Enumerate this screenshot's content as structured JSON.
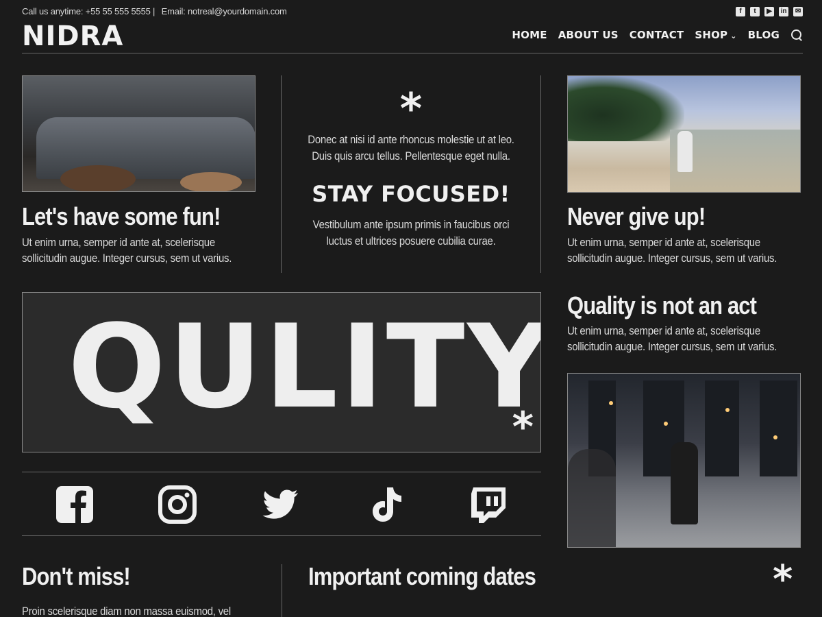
{
  "topbar": {
    "phone": "Call us anytime: +55 55 555 5555 |",
    "email": "Email: notreal@yourdomain.com",
    "social_icons": [
      "facebook-icon",
      "twitter-icon",
      "youtube-icon",
      "linkedin-icon",
      "mail-icon"
    ]
  },
  "header": {
    "logo": "NIDRA",
    "nav": {
      "home": "HOME",
      "about": "ABOUT US",
      "contact": "CONTACT",
      "shop": "SHOP",
      "blog": "BLOG"
    }
  },
  "card_left": {
    "title": "Let's have some fun!",
    "text": "Ut enim urna, semper id ante at, scelerisque sollicitudin augue. Integer cursus, sem ut varius."
  },
  "center": {
    "asterisk": "*",
    "text1_line1": "Donec at nisi id ante rhoncus molestie ut at leo.",
    "text1_line2": "Duis quis arcu tellus. Pellentesque eget nulla.",
    "heading": "STAY FOCUSED!",
    "text2_line1": "Vestibulum ante ipsum primis in faucibus orci",
    "text2_line2": "luctus et ultrices posuere cubilia curae."
  },
  "card_right": {
    "title": "Never give up!",
    "text": "Ut enim urna, semper id ante at, scelerisque sollicitudin augue. Integer cursus, sem ut varius."
  },
  "quality": {
    "big_text": "QULITY",
    "asterisk": "*"
  },
  "quality_side": {
    "title": "Quality is not an act",
    "text": "Ut enim urna, semper id ante at, scelerisque sollicitudin augue. Integer cursus, sem ut varius."
  },
  "social_row": {
    "icons": [
      "facebook-icon",
      "instagram-icon",
      "twitter-icon",
      "tiktok-icon",
      "twitch-icon"
    ]
  },
  "dont_miss": {
    "title": "Don't miss!",
    "text": "Proin scelerisque diam non massa euismod, vel"
  },
  "dates": {
    "title": "Important coming dates",
    "asterisk": "*"
  },
  "colors": {
    "background": "#1b1b1b",
    "text": "#e8e8e8",
    "box": "#2b2b2b",
    "divider": "#6a6a6a"
  }
}
